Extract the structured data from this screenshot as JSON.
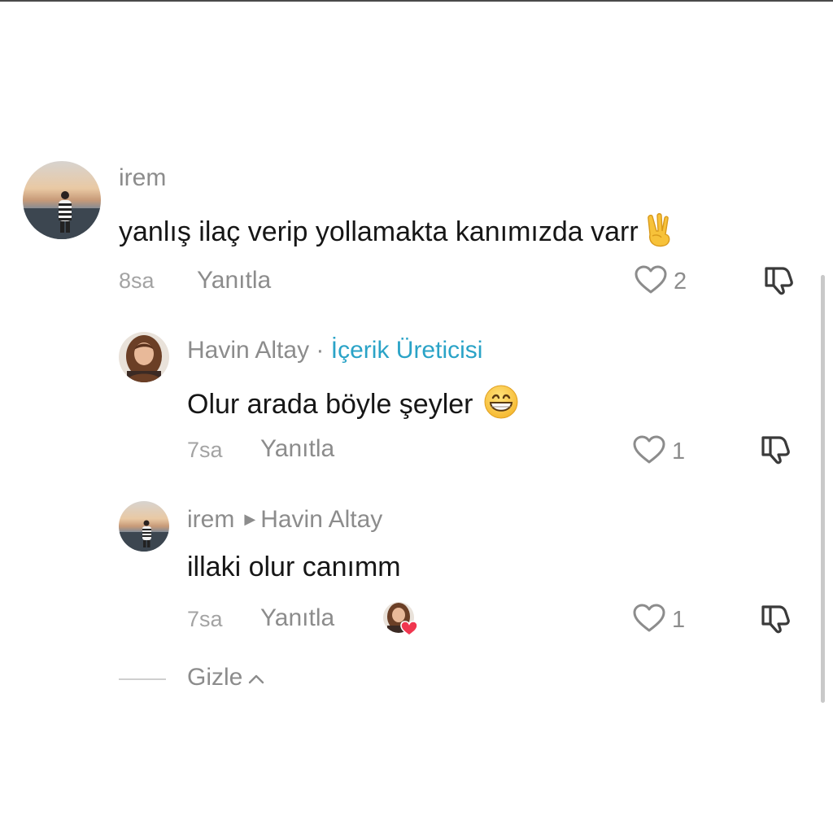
{
  "comments": [
    {
      "username": "irem",
      "text": "yanlış ilaç verip yollamakta kanımızda varr",
      "emoji": "victory-hand",
      "time": "8sa",
      "reply_label": "Yanıtla",
      "likes": "2"
    }
  ],
  "replies": [
    {
      "username": "Havin Altay",
      "separator": "·",
      "badge": "İçerik Üreticisi",
      "text": "Olur arada böyle şeyler",
      "emoji": "grinning-face",
      "time": "7sa",
      "reply_label": "Yanıtla",
      "likes": "1"
    },
    {
      "username": "irem",
      "reply_to": "Havin Altay",
      "text": "illaki olur canımm",
      "time": "7sa",
      "reply_label": "Yanıtla",
      "liked_by_creator": true,
      "likes": "1"
    }
  ],
  "hide_label": "Gizle",
  "colors": {
    "badge": "#2aa3c7",
    "muted": "#8c8c8c",
    "text": "#161616",
    "heart": "#f0364f"
  }
}
